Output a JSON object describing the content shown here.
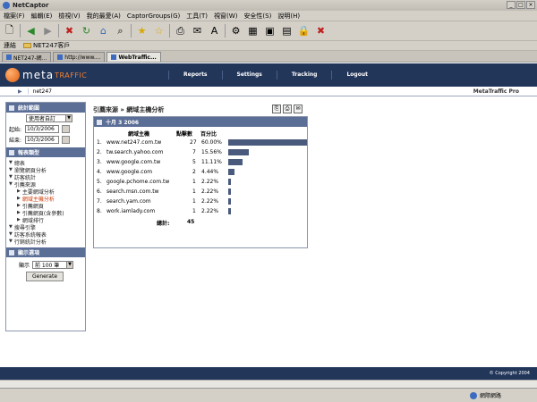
{
  "window": {
    "title": "NetCaptor"
  },
  "menubar": [
    "檔案(F)",
    "編輯(E)",
    "檢視(V)",
    "我的最愛(A)",
    "CaptorGroups(G)",
    "工具(T)",
    "視窗(W)",
    "安全性(S)",
    "說明(H)"
  ],
  "linksbar": {
    "label": "連結",
    "folder": "NET247客戶"
  },
  "tabs": [
    {
      "label": "NET247-網..."
    },
    {
      "label": "http://www...."
    },
    {
      "label": "WebTraffic..."
    }
  ],
  "header": {
    "logo_meta": "meta",
    "logo_traffic": "TRAFFIC",
    "nav": [
      "Reports",
      "Settings",
      "Tracking",
      "Logout"
    ]
  },
  "subheader": {
    "site": "net247",
    "product": "MetaTraffic Pro"
  },
  "sidebar": {
    "stats_range_title": "統計範圍",
    "range_select": "使用者自訂",
    "start_label": "起始:",
    "start_date": "10/3/2006",
    "end_label": "結束:",
    "end_date": "10/3/2006",
    "report_type_title": "報表類型",
    "tree": [
      {
        "label": "總表",
        "level": 1,
        "active": false
      },
      {
        "label": "瀏覽網頁分析",
        "level": 1,
        "active": false
      },
      {
        "label": "訪客統計",
        "level": 1,
        "active": false
      },
      {
        "label": "引薦來源",
        "level": 1,
        "active": false
      },
      {
        "label": "主要網域分析",
        "level": 2,
        "active": false
      },
      {
        "label": "網域主機分析",
        "level": 2,
        "active": true
      },
      {
        "label": "引薦網頁",
        "level": 2,
        "active": false
      },
      {
        "label": "引薦網頁(含參數)",
        "level": 2,
        "active": false
      },
      {
        "label": "網域排行",
        "level": 2,
        "active": false
      },
      {
        "label": "搜尋引擎",
        "level": 1,
        "active": false
      },
      {
        "label": "訪客系統報表",
        "level": 1,
        "active": false
      },
      {
        "label": "行銷統計分析",
        "level": 1,
        "active": false
      }
    ],
    "display_title": "顯示選項",
    "show_label": "顯示",
    "show_select": "前 100 筆",
    "generate_label": "Generate"
  },
  "main": {
    "breadcrumb": "引薦來源 » 網域主機分析",
    "panel_title": "十月 3 2006",
    "col_host": "網域主機",
    "col_clicks": "點擊數",
    "col_percent": "百分比",
    "total_label": "總計:",
    "total_value": "45"
  },
  "chart_data": {
    "type": "bar",
    "categories": [
      "www.net247.com.tw",
      "tw.search.yahoo.com",
      "www.google.com.tw",
      "www.google.com",
      "google.pchome.com.tw",
      "search.msn.com.tw",
      "search.yam.com",
      "work.iamlady.com"
    ],
    "values": [
      27,
      7,
      5,
      2,
      1,
      1,
      1,
      1
    ],
    "percent_labels": [
      "60.00%",
      "15.56%",
      "11.11%",
      "4.44%",
      "2.22%",
      "2.22%",
      "2.22%",
      "2.22%"
    ],
    "percents": [
      60.0,
      15.56,
      11.11,
      4.44,
      2.22,
      2.22,
      2.22,
      2.22
    ],
    "xlim": [
      0,
      60
    ]
  },
  "footer": {
    "copyright": "© Copyright 2004"
  },
  "status": {
    "zone": "網際網路"
  }
}
